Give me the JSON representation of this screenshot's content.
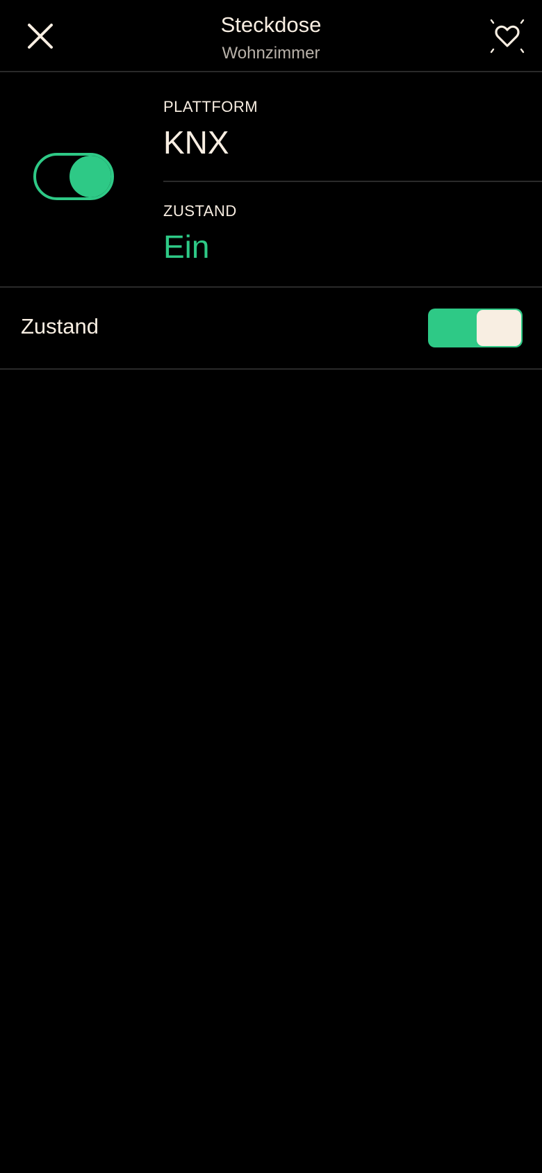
{
  "header": {
    "title": "Steckdose",
    "subtitle": "Wohnzimmer",
    "close_icon": "close-icon",
    "favorite_icon": "heart-sparkle-icon"
  },
  "info": {
    "device_toggle_state": "on",
    "platform": {
      "label": "PLATTFORM",
      "value": "KNX"
    },
    "state": {
      "label": "ZUSTAND",
      "value": "Ein"
    }
  },
  "controls": {
    "state_row": {
      "label": "Zustand",
      "switch_on": true
    }
  },
  "colors": {
    "background": "#000000",
    "accent": "#2ec986",
    "text": "#f8eee2",
    "muted": "#b9b2aa",
    "divider": "#2a2a2a"
  }
}
